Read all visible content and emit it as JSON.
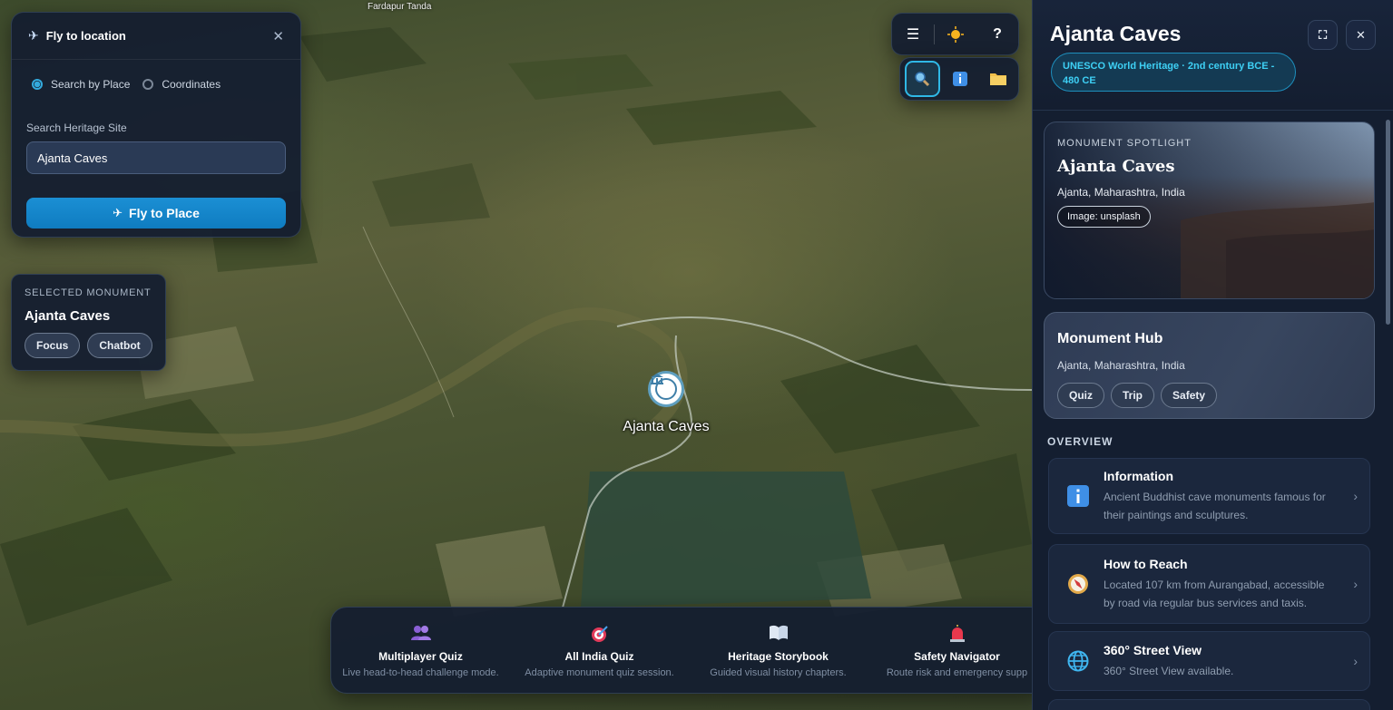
{
  "map": {
    "top_label": "Fardapur Tanda",
    "pin_label": "Ajanta Caves"
  },
  "fly_panel": {
    "title": "Fly to location",
    "radio_place": "Search by Place",
    "radio_coords": "Coordinates",
    "search_label": "Search Heritage Site",
    "search_value": "Ajanta Caves",
    "button_label": "Fly to Place"
  },
  "selected": {
    "caption": "SELECTED MONUMENT",
    "name": "Ajanta Caves",
    "focus_label": "Focus",
    "chatbot_label": "Chatbot"
  },
  "toolbar": {
    "menu_icon": "menu-icon",
    "theme_icon": "sun-icon",
    "help_label": "?",
    "search_icon": "search-icon",
    "info_icon": "info-icon",
    "folder_icon": "folder-icon"
  },
  "bottom_bar": [
    {
      "icon": "people-icon",
      "title": "Multiplayer Quiz",
      "desc": "Live head-to-head challenge mode."
    },
    {
      "icon": "target-icon",
      "title": "All India Quiz",
      "desc": "Adaptive monument quiz session."
    },
    {
      "icon": "book-icon",
      "title": "Heritage Storybook",
      "desc": "Guided visual history chapters."
    },
    {
      "icon": "siren-icon",
      "title": "Safety Navigator",
      "desc": "Route risk and emergency supp"
    }
  ],
  "sidebar": {
    "title": "Ajanta Caves",
    "badge": "UNESCO World Heritage · 2nd century BCE - 480 CE",
    "spotlight": {
      "caption": "MONUMENT SPOTLIGHT",
      "name": "Ajanta Caves",
      "location": "Ajanta, Maharashtra, India",
      "image_credit": "Image: unsplash"
    },
    "hub": {
      "title": "Monument Hub",
      "location": "Ajanta, Maharashtra, India",
      "quiz_label": "Quiz",
      "trip_label": "Trip",
      "safety_label": "Safety"
    },
    "overview_label": "OVERVIEW",
    "overview": [
      {
        "icon": "info-icon",
        "title": "Information",
        "desc": "Ancient Buddhist cave monuments famous for their paintings and sculptures."
      },
      {
        "icon": "compass-icon",
        "title": "How to Reach",
        "desc": "Located 107 km from Aurangabad, accessible by road via regular bus services and taxis."
      },
      {
        "icon": "globe-icon",
        "title": "360° Street View",
        "desc": "360° Street View available."
      }
    ]
  },
  "colors": {
    "accent": "#1b8fd4",
    "badge_text": "#3ed0f5",
    "panel_bg": "#141e30"
  }
}
